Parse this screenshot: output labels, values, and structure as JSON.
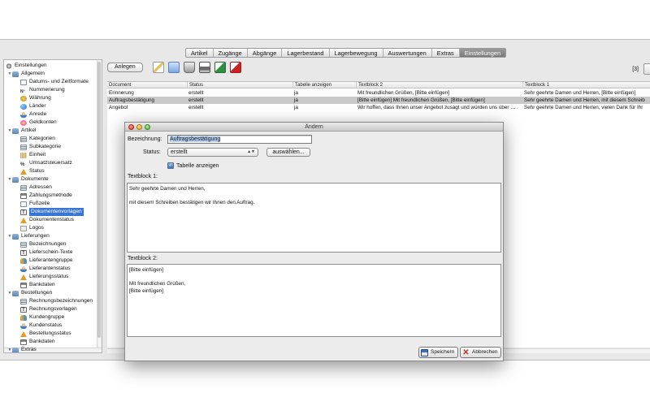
{
  "tabs": [
    "Artikel",
    "Zugänge",
    "Abgänge",
    "Lagerbestand",
    "Lagerbewegung",
    "Auswertungen",
    "Extras",
    "Einstellungen"
  ],
  "active_tab": "Einstellungen",
  "tree": [
    {
      "label": "Einstellungen",
      "level": 0,
      "icon": "gear-icon"
    },
    {
      "label": "Allgemein",
      "level": 1,
      "icon": "folder-icon"
    },
    {
      "label": "Datums- und Zeitformate",
      "level": 2,
      "icon": "calendar-icon"
    },
    {
      "label": "Nummerierung",
      "level": 2,
      "icon": "number-icon"
    },
    {
      "label": "Währung",
      "level": 2,
      "icon": "currency-icon"
    },
    {
      "label": "Länder",
      "level": 2,
      "icon": "globe-icon"
    },
    {
      "label": "Anrede",
      "level": 2,
      "icon": "person-icon"
    },
    {
      "label": "Geldkonten",
      "level": 2,
      "icon": "coin-icon"
    },
    {
      "label": "Artikel",
      "level": 1,
      "icon": "folder-icon"
    },
    {
      "label": "Kategorien",
      "level": 2,
      "icon": "list-icon"
    },
    {
      "label": "Subkategorie",
      "level": 2,
      "icon": "list-icon"
    },
    {
      "label": "Einheit",
      "level": 2,
      "icon": "ruler-icon"
    },
    {
      "label": "Umsatzsteuersatz",
      "level": 2,
      "icon": "percent-icon"
    },
    {
      "label": "Status",
      "level": 2,
      "icon": "warning-icon"
    },
    {
      "label": "Dokumente",
      "level": 1,
      "icon": "folder-icon"
    },
    {
      "label": "Adressen",
      "level": 2,
      "icon": "address-icon"
    },
    {
      "label": "Zahlungsmethode",
      "level": 2,
      "icon": "payment-icon"
    },
    {
      "label": "Fußzeile",
      "level": 2,
      "icon": "document-icon"
    },
    {
      "label": "Dokumentenvorlagen",
      "level": 2,
      "icon": "text-template-icon",
      "selected": true
    },
    {
      "label": "Dokumentenstatus",
      "level": 2,
      "icon": "warning-icon"
    },
    {
      "label": "Logos",
      "level": 2,
      "icon": "image-icon"
    },
    {
      "label": "Lieferungen",
      "level": 1,
      "icon": "folder-icon"
    },
    {
      "label": "Bezeichnungen",
      "level": 2,
      "icon": "list-icon"
    },
    {
      "label": "Lieferschein-Texte",
      "level": 2,
      "icon": "text-template-icon"
    },
    {
      "label": "Lieferantengruppe",
      "level": 2,
      "icon": "group-icon"
    },
    {
      "label": "Lieferantenstatus",
      "level": 2,
      "icon": "person-icon"
    },
    {
      "label": "Lieferungsstatus",
      "level": 2,
      "icon": "warning-icon"
    },
    {
      "label": "Bankdaten",
      "level": 2,
      "icon": "bank-icon"
    },
    {
      "label": "Bestellungen",
      "level": 1,
      "icon": "folder-icon"
    },
    {
      "label": "Rechnungsbezeichnungen",
      "level": 2,
      "icon": "list-icon"
    },
    {
      "label": "Rechnungsvorlagen",
      "level": 2,
      "icon": "text-template-icon"
    },
    {
      "label": "Kundengruppe",
      "level": 2,
      "icon": "group-icon"
    },
    {
      "label": "Kundenstatus",
      "level": 2,
      "icon": "person-icon"
    },
    {
      "label": "Bestellungsstatus",
      "level": 2,
      "icon": "warning-icon"
    },
    {
      "label": "Bankdaten",
      "level": 2,
      "icon": "bank-icon"
    },
    {
      "label": "Extras",
      "level": 1,
      "icon": "folder-icon"
    }
  ],
  "toolbar": {
    "add_label": "Anlegen",
    "count": "[3]"
  },
  "table": {
    "columns": [
      "Document",
      "Status",
      "Tabelle anzeigen",
      "Textblock 2",
      "Textblock 1"
    ],
    "rows": [
      [
        "Erinnerung",
        "erstellt",
        "ja",
        "Mit freundlichen Grüßen, [Bitte einfügen]",
        "Sehr geehrte Damen und Herren,  [Bitte einfügen]"
      ],
      [
        "Auftragsbestätigung",
        "erstellt",
        "ja",
        "[Bitte einfügen]  Mit freundlichen Grüßen, [Bitte einfügen]",
        "Sehr geehrte Damen und Herren,  mit diesem Schreib"
      ],
      [
        "Angebot",
        "erstellt",
        "ja",
        "Wir hoffen, dass Ihnen unser Angebot zusagt und würden uns über …",
        "Sehr geehrte Damen und Herren,  vielen Dank für Ihr"
      ]
    ],
    "selected_row": 1
  },
  "dialog": {
    "title": "Ändern",
    "name_label": "Bezeichnung:",
    "name_value": "Auftragsbestätigung",
    "status_label": "Status:",
    "status_value": "erstellt",
    "choose_label": "auswählen...",
    "show_table_label": "Tabelle anzeigen",
    "show_table_checked": true,
    "tb1_label": "Textblock 1:",
    "tb1_lines": [
      "Sehr geehrte Damen und Herren,",
      "",
      "mit diesem Schreiben bestätigen wir Ihnen den Auftrag."
    ],
    "tb2_label": "Textblock 2:",
    "tb2_lines": [
      "[Bitte einfügen]",
      "",
      "Mit freundlichen Grüßen,",
      "[Bitte einfügen]"
    ],
    "save_label": "Speichern",
    "cancel_label": "Abbrechen"
  }
}
